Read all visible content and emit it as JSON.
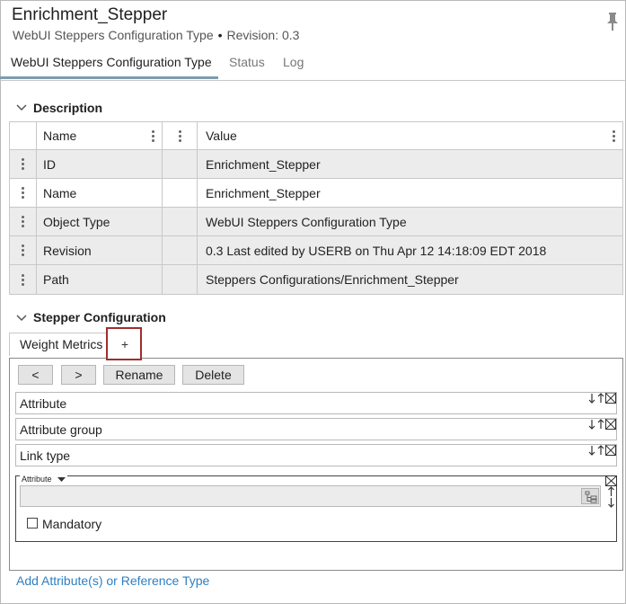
{
  "header": {
    "title": "Enrichment_Stepper",
    "subtitle_type": "WebUI Steppers Configuration Type",
    "subtitle_revision": "Revision: 0.3"
  },
  "tabs": [
    {
      "label": "WebUI Steppers Configuration Type",
      "active": true
    },
    {
      "label": "Status",
      "active": false
    },
    {
      "label": "Log",
      "active": false
    }
  ],
  "description": {
    "heading": "Description",
    "columns": {
      "name": "Name",
      "value": "Value"
    },
    "rows": [
      {
        "name": "ID",
        "value": "Enrichment_Stepper"
      },
      {
        "name": "Name",
        "value": "Enrichment_Stepper"
      },
      {
        "name": "Object Type",
        "value": "WebUI Steppers Configuration Type"
      },
      {
        "name": "Revision",
        "value": "0.3 Last edited by USERB on Thu Apr 12 14:18:09 EDT 2018"
      },
      {
        "name": "Path",
        "value": "Steppers Configurations/Enrichment_Stepper"
      }
    ]
  },
  "stepper": {
    "heading": "Stepper Configuration",
    "tab_label": "Weight Metrics",
    "add_tab_label": "+",
    "buttons": {
      "prev": "<",
      "next": ">",
      "rename": "Rename",
      "delete": "Delete"
    },
    "fields": [
      "Attribute",
      "Attribute group",
      "Link type"
    ],
    "attr_legend": "Attribute",
    "mandatory_label": "Mandatory",
    "mandatory_checked": false
  },
  "footer": {
    "add_link": "Add Attribute(s) or Reference Type"
  },
  "colors": {
    "link": "#2f7fc1",
    "highlight": "#a02d2d",
    "tab_underline": "#7e9dad"
  }
}
